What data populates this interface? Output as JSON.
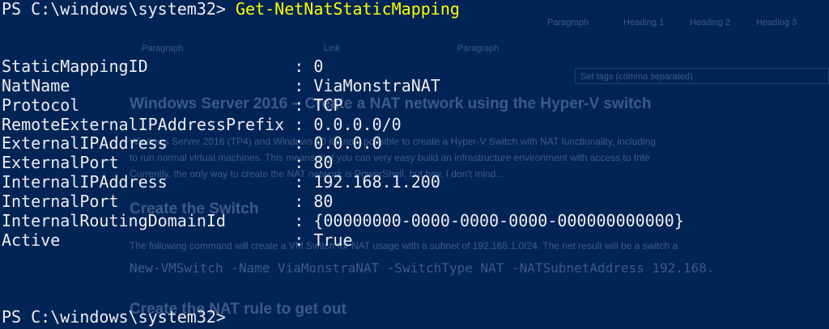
{
  "background_document": {
    "ribbon": [
      "Paragraph",
      "Heading 1",
      "Heading 2",
      "Heading 3"
    ],
    "labels": [
      "Paragraph",
      "Link",
      "Paragraph"
    ],
    "tags_placeholder": "Set tags (comma separated)",
    "heading": "Windows Server 2016 – Create a NAT network using the Hyper-V switch",
    "paragraph_lines": [
      "Windows Server 2016 (TP4) and Windows 10 it's now possible to create a Hyper-V Switch with NAT functionality, including",
      "to run normal virtual machines. This means that you can very easy build an infrastructure environment with access to Inte",
      "Currently, the only way to create the NAT network is PowerShell, but hey, I don't mind..."
    ],
    "heading_switch": "Create the Switch",
    "switch_paragraph": "The following command will create a VM Switch for NAT usage with a subnet of 192.168.1.0/24. The net result will be a switch a",
    "code_line": "New-VMSwitch -Name ViaMonstraNAT -SwitchType NAT -NATSubnetAddress 192.168.",
    "heading_nat": "Create the NAT rule to get out"
  },
  "console": {
    "prompt": "PS C:\\windows\\system32> ",
    "command": "Get-NetNatStaticMapping",
    "output": [
      {
        "key": "StaticMappingID               ",
        "value": "0"
      },
      {
        "key": "NatName                       ",
        "value": "ViaMonstraNAT"
      },
      {
        "key": "Protocol                      ",
        "value": "TCP"
      },
      {
        "key": "RemoteExternalIPAddressPrefix ",
        "value": "0.0.0.0/0"
      },
      {
        "key": "ExternalIPAddress             ",
        "value": "0.0.0.0"
      },
      {
        "key": "ExternalPort                  ",
        "value": "80"
      },
      {
        "key": "InternalIPAddress             ",
        "value": "192.168.1.200"
      },
      {
        "key": "InternalPort                  ",
        "value": "80"
      },
      {
        "key": "InternalRoutingDomainId       ",
        "value": "{00000000-0000-0000-0000-000000000000}"
      },
      {
        "key": "Active                        ",
        "value": "True"
      }
    ],
    "separator": ": ",
    "final_prompt": "PS C:\\windows\\system32>"
  },
  "colors": {
    "background": "#012456",
    "text": "#eeedf0",
    "command": "#fefe00"
  }
}
